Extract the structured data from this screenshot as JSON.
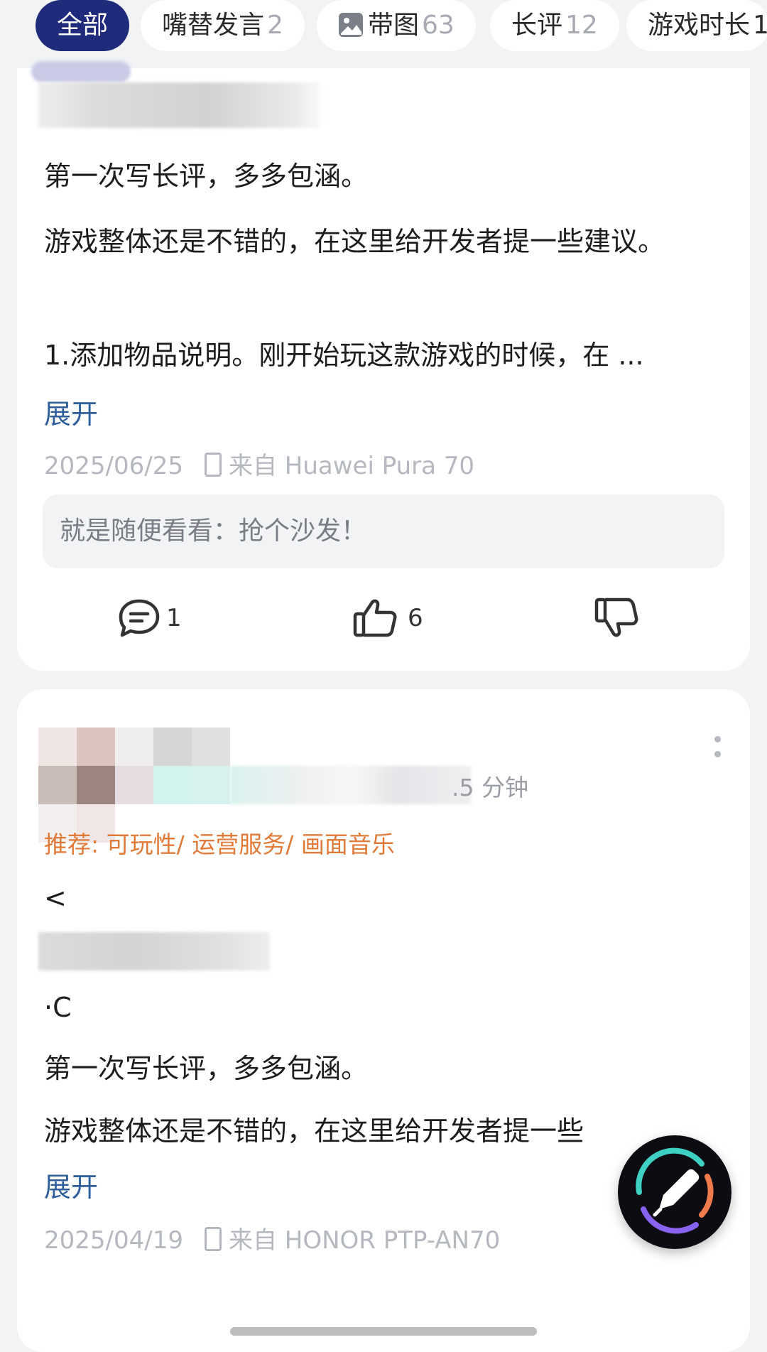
{
  "filters": [
    {
      "label": "全部",
      "count": ""
    },
    {
      "label": "嘴替发言",
      "count": "2"
    },
    {
      "label": "带图",
      "count": "63"
    },
    {
      "label": "长评",
      "count": "12"
    },
    {
      "label": "游戏时长",
      "count": "1"
    }
  ],
  "review1": {
    "para1": "第一次写长评，多多包涵。",
    "para2": "游戏整体还是不错的，在这里给开发者提一些建议。",
    "para3": "1.添加物品说明。刚开始玩这款游戏的时候，在 ...",
    "expand": "展开",
    "date": "2025/06/25",
    "device": "来自 Huawei Pura 70",
    "reply": "就是随便看看：抢个沙发！",
    "comments": "1",
    "likes": "6"
  },
  "review2": {
    "playtime_fragment": ".5 分钟",
    "tags": "推荐: 可玩性/ 运营服务/ 画面音乐",
    "line_a": "<",
    "line_b": "·C",
    "para1": "第一次写长评，多多包涵。",
    "para2": "游戏整体还是不错的，在这里给开发者提一些",
    "expand": "展开",
    "date": "2025/04/19",
    "device": "来自 HONOR PTP-AN70"
  },
  "icons": {
    "comment": "comment-icon",
    "like": "thumbs-up-icon",
    "dislike": "thumbs-down-icon",
    "image": "image-icon",
    "edit": "pencil-icon",
    "more": "more-vertical-icon",
    "device": "phone-icon"
  },
  "colors": {
    "active_chip": "#1f2a7a",
    "link": "#2f5f9a",
    "tag": "#e07a38"
  }
}
